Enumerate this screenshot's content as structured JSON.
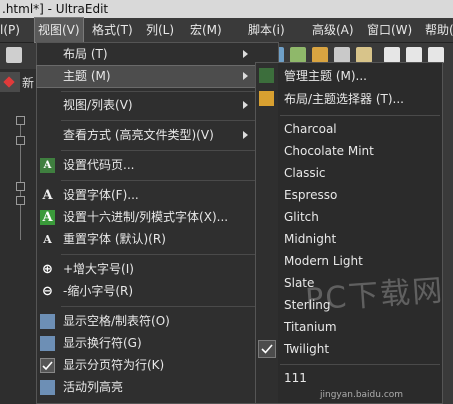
{
  "window": {
    "title": ".html*] - UltraEdit"
  },
  "menubar": {
    "items": [
      {
        "label": "l(P)"
      },
      {
        "label": "视图(V)"
      },
      {
        "label": "格式(T)"
      },
      {
        "label": "列(L)"
      },
      {
        "label": "宏(M)"
      },
      {
        "label": "脚本(i)"
      },
      {
        "label": "高级(A)"
      },
      {
        "label": "窗口(W)"
      },
      {
        "label": "帮助(H)"
      }
    ]
  },
  "tab": {
    "label": "新"
  },
  "view_menu": {
    "items": [
      {
        "label": "布局 (T)",
        "submenu": true
      },
      {
        "label": "主题 (M)",
        "submenu": true,
        "highlighted": true
      },
      {
        "label": "视图/列表(V)",
        "submenu": true
      },
      {
        "label": "查看方式 (高亮文件类型)(V)",
        "submenu": true
      },
      {
        "label": "设置代码页..."
      },
      {
        "label": "设置字体(F)..."
      },
      {
        "label": "设置十六进制/列模式字体(X)..."
      },
      {
        "label": "重置字体 (默认)(R)"
      },
      {
        "label": "+增大字号(I)"
      },
      {
        "label": "-缩小字号(R)"
      },
      {
        "label": "显示空格/制表符(O)"
      },
      {
        "label": "显示换行符(G)"
      },
      {
        "label": "显示分页符为行(K)"
      },
      {
        "label": "活动列高亮"
      }
    ]
  },
  "theme_submenu": {
    "actions": [
      {
        "label": "管理主题 (M)..."
      },
      {
        "label": "布局/主题选择器 (T)..."
      }
    ],
    "themes": [
      {
        "label": "Charcoal"
      },
      {
        "label": "Chocolate Mint"
      },
      {
        "label": "Classic"
      },
      {
        "label": "Espresso"
      },
      {
        "label": "Glitch"
      },
      {
        "label": "Midnight"
      },
      {
        "label": "Modern Light"
      },
      {
        "label": "Slate"
      },
      {
        "label": "Sterling"
      },
      {
        "label": "Titanium"
      },
      {
        "label": "Twilight",
        "checked": true
      },
      {
        "label": "111"
      }
    ]
  },
  "watermark": {
    "text": "PC下载网",
    "sub": "jingyan.baidu.com"
  }
}
